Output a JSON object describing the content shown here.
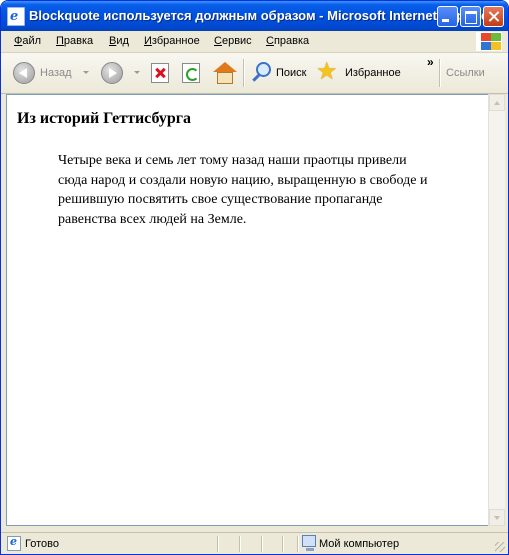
{
  "window": {
    "title": "Blockquote используется должным образом - Microsoft Internet Explorer"
  },
  "menubar": {
    "items": [
      "Файл",
      "Правка",
      "Вид",
      "Избранное",
      "Сервис",
      "Справка"
    ]
  },
  "toolbar": {
    "back_label": "Назад",
    "search_label": "Поиск",
    "favorites_label": "Избранное",
    "overflow_label": "»",
    "links_label": "Ссылки"
  },
  "page": {
    "heading": "Из историй Геттисбурга",
    "quote": "Четыре века и семь лет тому назад наши праотцы привели сюда народ и создали новую нацию, выращенную в свободе и решившую посвятить свое существование пропаганде равенства всех людей на Земле."
  },
  "statusbar": {
    "status": "Готово",
    "zone": "Мой компьютер"
  }
}
